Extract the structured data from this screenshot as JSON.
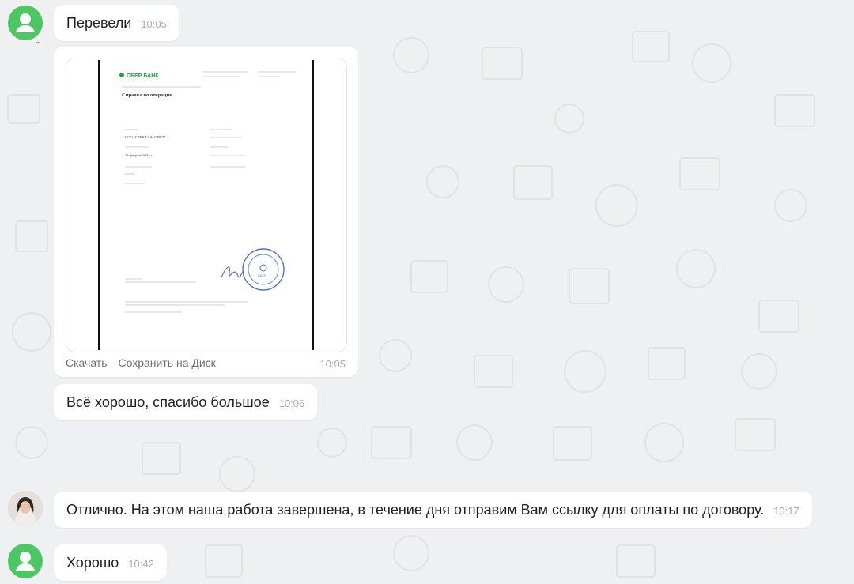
{
  "messages": [
    {
      "text": "Перевели",
      "time": "10:05"
    },
    {
      "time": "10:05",
      "actions": {
        "download": "Скачать",
        "save_disk": "Сохранить на Диск"
      },
      "doc": {
        "bank": "СБЕР БАНК",
        "title": "Справка по операции",
        "company": "ООО \"СЛИКА1 АССИСТ\"",
        "date": "16 февраля 2024 г.",
        "seal": "СБЕР"
      }
    },
    {
      "text": "Всё хорошо, спасибо большое",
      "time": "10:06"
    },
    {
      "text": "Отлично. На этом наша работа завершена, в течение дня отправим Вам ссылку для оплаты по договору.",
      "time": "10:17"
    },
    {
      "text": "Хорошо",
      "time": "10:42"
    }
  ],
  "colors": {
    "avatar_green": "#4cc764",
    "background": "#eef0f2",
    "bubble": "#ffffff",
    "time_text": "#a8adb3"
  }
}
